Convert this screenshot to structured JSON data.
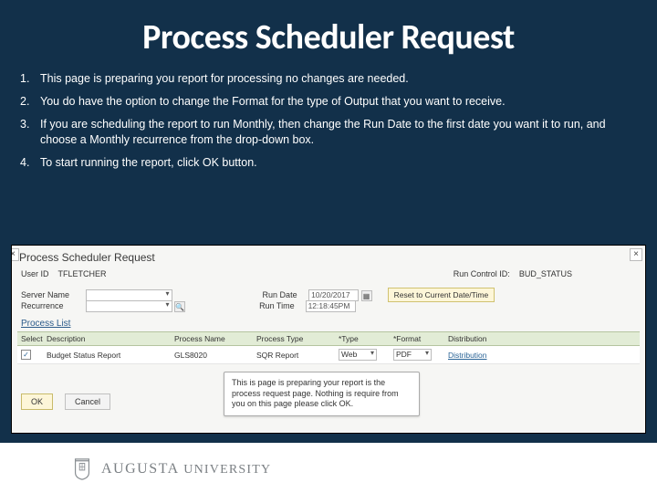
{
  "title": "Process Scheduler Request",
  "instructions": [
    "This page is preparing you report for processing no changes are needed.",
    "You do have the option to change the Format for the type of Output that you want to receive.",
    "If you are scheduling the report to run Monthly, then change the Run Date to the first date you want it to run, and choose a Monthly recurrence from the drop-down box.",
    "To start running the report, click OK button."
  ],
  "screenshot": {
    "header": "Process Scheduler Request",
    "userIdLabel": "User ID",
    "userId": "TFLETCHER",
    "runControlIdLabel": "Run Control ID:",
    "runControlId": "BUD_STATUS",
    "serverNameLabel": "Server Name",
    "serverName": "",
    "runDateLabel": "Run Date",
    "runDate": "10/20/2017",
    "resetBtn": "Reset to Current Date/Time",
    "recurrenceLabel": "Recurrence",
    "recurrence": "",
    "runTimeLabel": "Run Time",
    "runTime": "12:18:45PM",
    "processListLabel": "Process List",
    "columns": {
      "select": "Select",
      "description": "Description",
      "processName": "Process Name",
      "processType": "Process Type",
      "type": "*Type",
      "format": "*Format",
      "distribution": "Distribution"
    },
    "row": {
      "checked": "✓",
      "description": "Budget Status Report",
      "processName": "GLS8020",
      "processType": "SQR Report",
      "type": "Web",
      "format": "PDF",
      "distribution": "Distribution"
    },
    "okBtn": "OK",
    "cancelBtn": "Cancel",
    "callout": "This is page is preparing your report is the process request page. Nothing is require from you on this page please click OK."
  },
  "footer": {
    "name1": "AUGUSTA",
    "name2": "UNIVERSITY"
  }
}
